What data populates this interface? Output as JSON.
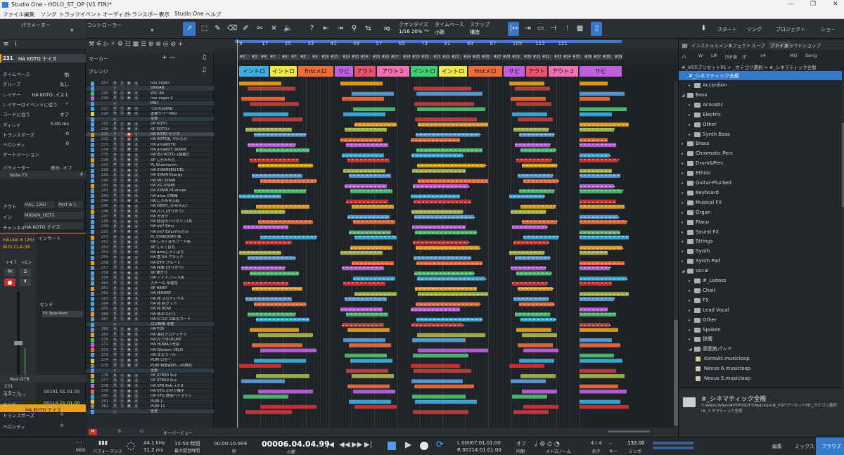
{
  "window": {
    "title": "Studio One - HOLO_ST_OP (V1 FIN)*",
    "min": "—",
    "max": "❐",
    "close": "✕"
  },
  "menu": [
    "ファイル",
    "編集",
    "ソング",
    "トラック",
    "イベント",
    "オーディオ",
    "トランスポート",
    "表示",
    "Studio One",
    "ヘルプ"
  ],
  "toolbar": {
    "params_label": "パラメーター",
    "controller_label": "コントローラー",
    "quantize_label": "クオンタイズ",
    "quantize_value": "1/16 20% ᵀʳᵖ",
    "timebase_label": "タイムベース",
    "timebase_value": "小節",
    "snap_label": "スナップ",
    "snap_value": "構造",
    "iq": "IQ",
    "start": "スタート",
    "song": "ソング",
    "project": "プロジェクト",
    "show": "ショー"
  },
  "inspector": {
    "track_num": "231",
    "track_name": "HA KOTO ナイス",
    "rows": [
      {
        "k": "タイムベース",
        "v": "拍"
      },
      {
        "k": "グループ",
        "v": "なし"
      },
      {
        "k": "レイヤー",
        "v": "HA KOTO..イス１"
      },
      {
        "k": "レイヤーはイベントに従う",
        "v": "✓"
      },
      {
        "k": "コードに従う",
        "v": "オフ"
      },
      {
        "k": "ディレイ",
        "v": "0.00 ms"
      },
      {
        "k": "トランスポーズ",
        "v": "0"
      },
      {
        "k": "ベロシティ",
        "v": "0"
      },
      {
        "k": "オートメーション",
        "v": ""
      }
    ],
    "param_label": "パラメーター",
    "param_display": "表示: オフ",
    "note_fx": "Note FX",
    "out_label": "アウト",
    "out_value": "HAL..(26)",
    "port_value": "Port A 1",
    "in_label": "イン",
    "in_value": "MIOXM_HST1",
    "ch_label": "チャンネル",
    "ch_value": "HA KOTO ナイス",
    "instrument": "HALion 6 (26)",
    "bus": "BUS CLA-3A",
    "insert_label": "インサート",
    "send_label": "センド",
    "send_item": "FX SpanVerb",
    "vol": "+4.7",
    "pan": "<C>",
    "m": "M",
    "s": "S",
    "fader_val": "231",
    "auto": "オート: オフ",
    "channel_name": "HA KOTO ナイス",
    "gtr_name": "Nex GTR",
    "start_label": "スタート",
    "start_value": "00101.01.01.00",
    "end_label": "エンド",
    "end_value": "00114.01.01.00",
    "tp_label": "トランスポーズ",
    "tp_value": "0",
    "vel_label": "ベロシティ",
    "vel_value": "0"
  },
  "tracklist": {
    "marker_label": "マーカー",
    "arrange_label": "アレンジ",
    "overview_label": "オーバービュー",
    "tracks": [
      [
        "224",
        "nex organ"
      ],
      [
        "",
        "ORGAN"
      ],
      [
        "225",
        "VSC 84"
      ],
      [
        "226",
        "nex organ 2"
      ],
      [
        "",
        "PAD"
      ],
      [
        "227",
        "つみれ回PAD"
      ],
      [
        "228",
        "透徹りバーPAD"
      ],
      [
        "",
        "全部"
      ],
      [
        "229",
        "OP KOTO"
      ],
      [
        "230",
        "XP KOTO+"
      ],
      [
        "231",
        "HA KOTO ナイス"
      ],
      [
        "232",
        "HA KOTO乱 やわらか"
      ],
      [
        "233",
        "HA amaKOTO"
      ],
      [
        "234",
        "HA amaKOT..NORM"
      ],
      [
        "235",
        "HA 低いKOTO..(音量だ"
      ],
      [
        "236",
        "XP しかみせん"
      ],
      [
        "237",
        "PL Shamisenn"
      ],
      [
        "238",
        "HA SYAMISEN DEL"
      ],
      [
        "239",
        "HA SYAMI Energy"
      ],
      [
        "240",
        "HA MU SYAMI"
      ],
      [
        "241",
        "HA XG SYAMI"
      ],
      [
        "242",
        "HA SYAMI HCanvas"
      ],
      [
        "243",
        "HA ama 三味線"
      ],
      [
        "244",
        "HA しかみせん乱"
      ],
      [
        "245",
        "HA DEEPしかみせん？"
      ],
      [
        "246",
        "HA 尺八 (ぎりぎり)"
      ],
      [
        "247",
        "HA ガガク"
      ],
      [
        "248",
        "HA 和台のバイオリン(あ"
      ],
      [
        "249",
        "HA int7 Erhu"
      ],
      [
        "250",
        "HA int7 Erhuやわらか"
      ],
      [
        "251",
        "PL SYAKUHATI 新"
      ],
      [
        "252",
        "HA しゃくはちリード系"
      ],
      [
        "253",
        "XP しゃくはち"
      ],
      [
        "254",
        "HA amaしゃくはち"
      ],
      [
        "255",
        "HA 笛 SH アタック"
      ],
      [
        "256",
        "HA ETH フルート"
      ],
      [
        "257",
        "HA 和笛 (ぎりぎり)"
      ],
      [
        "258",
        "XP 摘ぎり"
      ],
      [
        "259",
        "HA ノイズ-ブレス系"
      ],
      [
        "260",
        "スチール 琴音性"
      ],
      [
        "261",
        "XP HARP"
      ],
      [
        "262",
        "HA 和HARP"
      ],
      [
        "263",
        "HA 和 メロディベル"
      ],
      [
        "264",
        "HA 和 鈴グッパ"
      ],
      [
        "265",
        "HA 和 BOW"
      ],
      [
        "266",
        "HA 和ボゴポコ"
      ],
      [
        "267",
        "HA ピコピコあるコード"
      ],
      [
        "",
        "ロロ時雨 余覧"
      ],
      [
        "268",
        "HA FOX"
      ],
      [
        "269",
        "HA 湯打グロテッチク"
      ],
      [
        "270",
        "HA JV CHILDLIKE"
      ],
      [
        "271",
        "HA HUWAカゼ鈴"
      ],
      [
        "272",
        "HA Glocken VELO"
      ],
      [
        "273",
        "HA オルゴール"
      ],
      [
        "274",
        "PURI ロゼー"
      ],
      [
        "275",
        "PURI 和音ARPL..ol(倒的"
      ],
      [
        "",
        "全部"
      ],
      [
        "276",
        "OP STR50 Sus"
      ],
      [
        "277",
        "OP STR50 Sus"
      ],
      [
        "278",
        "HA STR Extr +3 8"
      ],
      [
        "279",
        "HA STG ぶかり機子"
      ],
      [
        "280",
        "HA STG 感情バイオリン"
      ],
      [
        "281",
        "PURI 2"
      ],
      [
        "282",
        "PURI 11"
      ],
      [
        "",
        "全部"
      ]
    ]
  },
  "arrange": {
    "bars": [
      "9",
      "17",
      "25",
      "33",
      "41",
      "49",
      "57",
      "65",
      "73",
      "81",
      "89",
      "97",
      "105",
      "113",
      "121"
    ],
    "sections": [
      {
        "l": "イントロ",
        "c": "#3bb0e0"
      },
      {
        "l": "イントロ",
        "c": "#f0e64a"
      },
      {
        "l": "firstメロ",
        "c": "#f06a3a"
      },
      {
        "l": "サビ",
        "c": "#c060e0"
      },
      {
        "l": "アウト",
        "c": "#f05070"
      },
      {
        "l": "アウト２",
        "c": "#f070b0"
      },
      {
        "l": "イントロ",
        "c": "#3bd070"
      },
      {
        "l": "イントロ",
        "c": "#f0e64a"
      },
      {
        "l": "firstメロ",
        "c": "#f06a3a"
      },
      {
        "l": "サビ",
        "c": "#c060e0"
      },
      {
        "l": "アウト",
        "c": "#f05070"
      },
      {
        "l": "アウト２",
        "c": "#f070b0"
      },
      {
        "l": "サビ",
        "c": "#c060e0"
      }
    ]
  },
  "browser": {
    "tabs": [
      "インストゥルメント",
      "エフェクト",
      "ループ",
      "ファイル",
      "クラウド",
      "ショップ"
    ],
    "filters": [
      "ハ",
      "W",
      "LIF",
      "[SE自",
      "ボ",
      "v4",
      "MU",
      "Song"
    ],
    "breadcrumb": "#_VSTiプリセットPE >  _カテゴリ選択 > #_シネマティック全般",
    "selected": "#_シネマティック全般",
    "items": [
      {
        "l": "Accordion",
        "d": 1
      },
      {
        "l": "Bass",
        "d": 0
      },
      {
        "l": "Acoustic",
        "d": 1
      },
      {
        "l": "Electric",
        "d": 1
      },
      {
        "l": "Other",
        "d": 1
      },
      {
        "l": "Synth Bass",
        "d": 1
      },
      {
        "l": "Brass",
        "d": 0
      },
      {
        "l": "Chromatic Perc",
        "d": 0
      },
      {
        "l": "Drum&Perc",
        "d": 0
      },
      {
        "l": "Ethnic",
        "d": 0
      },
      {
        "l": "Guitar-Plucked",
        "d": 0
      },
      {
        "l": "Keyboard",
        "d": 0
      },
      {
        "l": "Musical FX",
        "d": 0
      },
      {
        "l": "Organ",
        "d": 0
      },
      {
        "l": "Piano",
        "d": 0
      },
      {
        "l": "Sound FX",
        "d": 0
      },
      {
        "l": "Strings",
        "d": 0
      },
      {
        "l": "Synth",
        "d": 0
      },
      {
        "l": "Synth Pad",
        "d": 0
      },
      {
        "l": "Vocal",
        "d": 0
      },
      {
        "l": "#_Lodoss",
        "d": 1
      },
      {
        "l": "Choir",
        "d": 1
      },
      {
        "l": "FX",
        "d": 1
      },
      {
        "l": "Lead Vocal",
        "d": 1
      },
      {
        "l": "Other",
        "d": 1
      },
      {
        "l": "Spoken",
        "d": 1
      },
      {
        "l": "掠魔",
        "d": 1
      },
      {
        "l": "雰囲気パッド",
        "d": 1
      },
      {
        "l": "Kontakt.musicloop",
        "d": 2
      },
      {
        "l": "Nexus 6.musicloop",
        "d": 2
      },
      {
        "l": "Nexus 5.musicloop",
        "d": 2
      }
    ],
    "footer_title": "#_シネマティック全般",
    "footer_path": "T:\\WAVs\\WAVs\\#PEPOSOFT\\MyLoops\\#_VSTiプリセットPE\\_カテゴリ選択\\#_シネマティック全般"
  },
  "transport": {
    "midi": "MIDI",
    "perf": "パフォーマンス",
    "rate": "44.1 kHz",
    "latency": "31.2 ms",
    "time": "15:59 時間",
    "rec_max": "最大録音時間",
    "pos1": "00:00:10.909",
    "pos1_unit": "秒",
    "pos_main": "00006.04.04.99",
    "pos_main_unit": "小節",
    "l_pos": "L 00007.01.01.00",
    "r_pos": "R 00114.01.01.00",
    "off": "オフ",
    "sync": "同期",
    "metronome": "メトロノーム",
    "timesig": "4 / 4",
    "timesig_label": "拍子",
    "key_label": "キー",
    "tempo": "132.00",
    "tempo_label": "テンポ",
    "edit": "編集",
    "mix": "ミックス",
    "browse": "ブラウズ"
  }
}
